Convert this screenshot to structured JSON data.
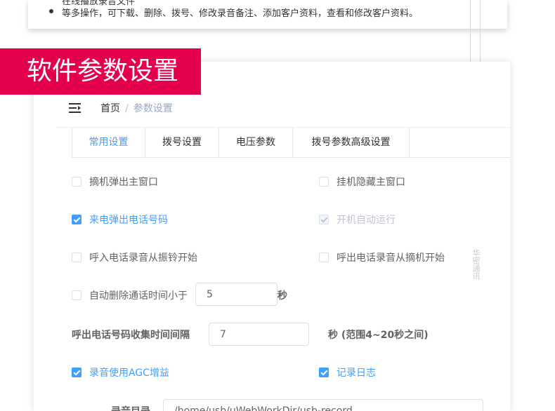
{
  "top_card": {
    "clipped_line": "在线播放录音文件",
    "bullet_text": "等多操作，可下载、删除、拨号、修改录音备注、添加客户资料，查看和修改客户资料。"
  },
  "section_banner": "软件参数设置",
  "watermark": "华密通讯",
  "breadcrumb": {
    "home": "首页",
    "separator": "/",
    "current": "参数设置"
  },
  "tabs": [
    {
      "label": "常用设置",
      "active": true
    },
    {
      "label": "拨号设置",
      "active": false
    },
    {
      "label": "电压参数",
      "active": false
    },
    {
      "label": "拨号参数高级设置",
      "active": false
    }
  ],
  "options": {
    "pickup_popup_main": {
      "label": "摘机弹出主窗口",
      "checked": false
    },
    "hangup_hide_main": {
      "label": "挂机隐藏主窗口",
      "checked": false
    },
    "incoming_popup_number": {
      "label": "来电弹出电话号码",
      "checked": true
    },
    "autostart_on_boot": {
      "label": "开机自动运行",
      "checked": true,
      "disabled": true
    },
    "incoming_record_from_ring": {
      "label": "呼入电话录音从振铃开始",
      "checked": false
    },
    "outgoing_record_from_pickup": {
      "label": "呼出电话录音从摘机开始",
      "checked": false
    },
    "auto_delete_short_calls": {
      "label": "自动删除通话时间小于",
      "checked": false,
      "value": "5",
      "unit": "秒"
    },
    "record_agc_gain": {
      "label": "录音使用AGC增益",
      "checked": true
    },
    "write_log": {
      "label": "记录日志",
      "checked": true
    }
  },
  "collect_interval": {
    "label": "呼出电话号码收集时间间隔",
    "value": "7",
    "unit": "秒 (范围4~20秒之间)"
  },
  "record_dir": {
    "label": "录音目录",
    "value": "/home/usb/uWebWorkDir/usb-record"
  },
  "colors": {
    "banner": "#e4004f",
    "accent": "#409eff"
  }
}
